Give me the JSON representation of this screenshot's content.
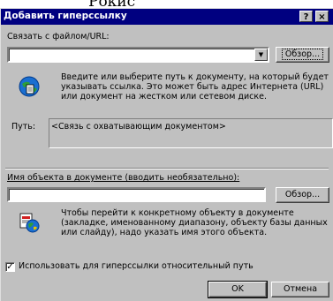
{
  "page_caption": "Рокис",
  "dialog": {
    "title": "Добавить гиперссылку",
    "help_glyph": "?",
    "close_glyph": "×",
    "link_section": {
      "label": "Связать с файлом/URL:",
      "value": "",
      "browse_label": "Обзор...",
      "hint": "Введите или выберите путь к документу, на который будет указывать ссылка. Это может быть адрес Интернета (URL) или документ на жестком или сетевом диске.",
      "icon": "globe-document-icon"
    },
    "path": {
      "label": "Путь:",
      "value": "<Связь с охватывающим документом>"
    },
    "object_section": {
      "label": "Имя объекта в документе (вводить необязательно):",
      "value": "",
      "browse_label": "Обзор...",
      "hint": "Чтобы перейти к конкретному объекту в документе (закладке, именованному диапазону, объекту базы данных или слайду), надо указать имя этого объекта.",
      "icon": "document-target-icon"
    },
    "relative_path": {
      "label": "Использовать для гиперссылки относительный путь",
      "checked": true,
      "check_glyph": "✓"
    },
    "ok_label": "OK",
    "cancel_label": "Отмена"
  },
  "colors": {
    "titlebar": "#000080",
    "face": "#c0c0c0"
  }
}
